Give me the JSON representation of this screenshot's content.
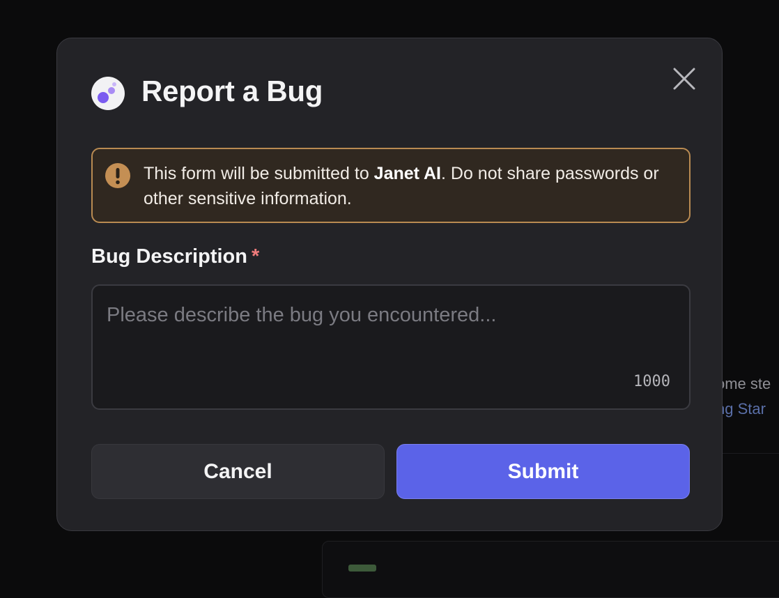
{
  "background": {
    "fragment_line1": "ome ste",
    "fragment_line2": "ng Star"
  },
  "modal": {
    "title": "Report a Bug",
    "logo_icon": "janet-ai-logo-icon",
    "close_icon": "close-icon",
    "notice": {
      "icon": "warning-icon",
      "text_before": "This form will be submitted to ",
      "text_bold": "Janet AI",
      "text_after": ". Do not share passwords or other sensitive information.",
      "border_color": "#b98b52"
    },
    "field": {
      "label": "Bug Description",
      "required_mark": "*",
      "placeholder": "Please describe the bug you encountered...",
      "value": "",
      "char_counter": "1000"
    },
    "buttons": {
      "cancel": "Cancel",
      "submit": "Submit"
    }
  },
  "colors": {
    "accent": "#5b63e8",
    "warning": "#c48f54",
    "required": "#f07c7c",
    "modal_bg": "#232327"
  }
}
